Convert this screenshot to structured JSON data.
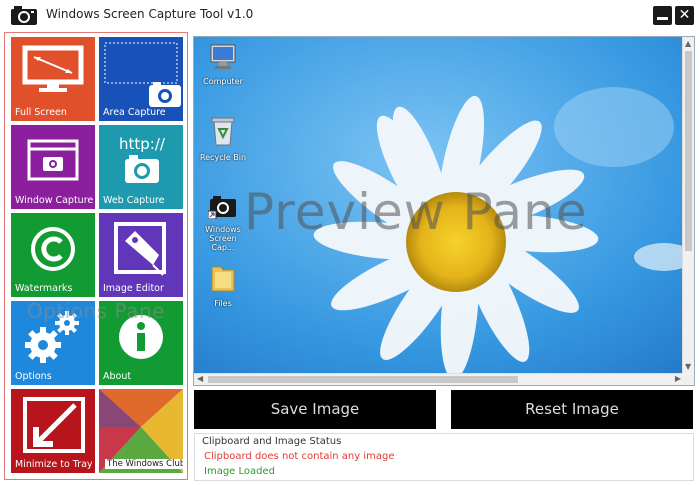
{
  "window": {
    "title": "Windows Screen Capture Tool v1.0",
    "app_icon": "camera-icon",
    "minimize_icon": "minimize-icon",
    "close_icon": "close-icon",
    "close_glyph": "✕"
  },
  "options_pane": {
    "watermark": "Options Pane",
    "tiles": [
      {
        "label": "Full Screen",
        "icon": "monitor-icon",
        "color": "#e0512b"
      },
      {
        "label": "Area Capture",
        "icon": "area-capture-icon",
        "color": "#1852b8"
      },
      {
        "label": "Window Capture",
        "icon": "window-camera-icon",
        "color": "#8b1f9e"
      },
      {
        "label": "Web Capture",
        "icon": "web-camera-icon",
        "color": "#1e9aae"
      },
      {
        "label": "Watermarks",
        "icon": "copyright-icon",
        "color": "#129a33"
      },
      {
        "label": "Image Editor",
        "icon": "image-editor-icon",
        "color": "#6236b8"
      },
      {
        "label": "Options",
        "icon": "gears-icon",
        "color": "#1e88dc"
      },
      {
        "label": "About",
        "icon": "info-icon",
        "color": "#129a33"
      },
      {
        "label": "Minimize to Tray",
        "icon": "minimize-arrow-icon",
        "color": "#b8141c"
      },
      {
        "label": "The Windows Club",
        "icon": "windows-club-logo",
        "color": "#ffffff"
      }
    ]
  },
  "preview": {
    "watermark": "Preview Pane",
    "desktop_icons": [
      {
        "label": "Computer",
        "icon": "computer-icon"
      },
      {
        "label": "Recycle Bin",
        "icon": "recycle-bin-icon"
      },
      {
        "label": "Windows Screen Cap...",
        "icon": "camera-shortcut-icon"
      },
      {
        "label": "Files",
        "icon": "folder-icon"
      }
    ],
    "scroll_arrows": {
      "up": "▲",
      "down": "▼",
      "left": "◀",
      "right": "▶"
    }
  },
  "actions": {
    "save_label": "Save Image",
    "reset_label": "Reset Image"
  },
  "status": {
    "title": "Clipboard and Image Status",
    "clipboard_message": "Clipboard does not contain any image",
    "image_message": "Image Loaded",
    "error_color": "#e53935",
    "ok_color": "#2e9a2e"
  }
}
